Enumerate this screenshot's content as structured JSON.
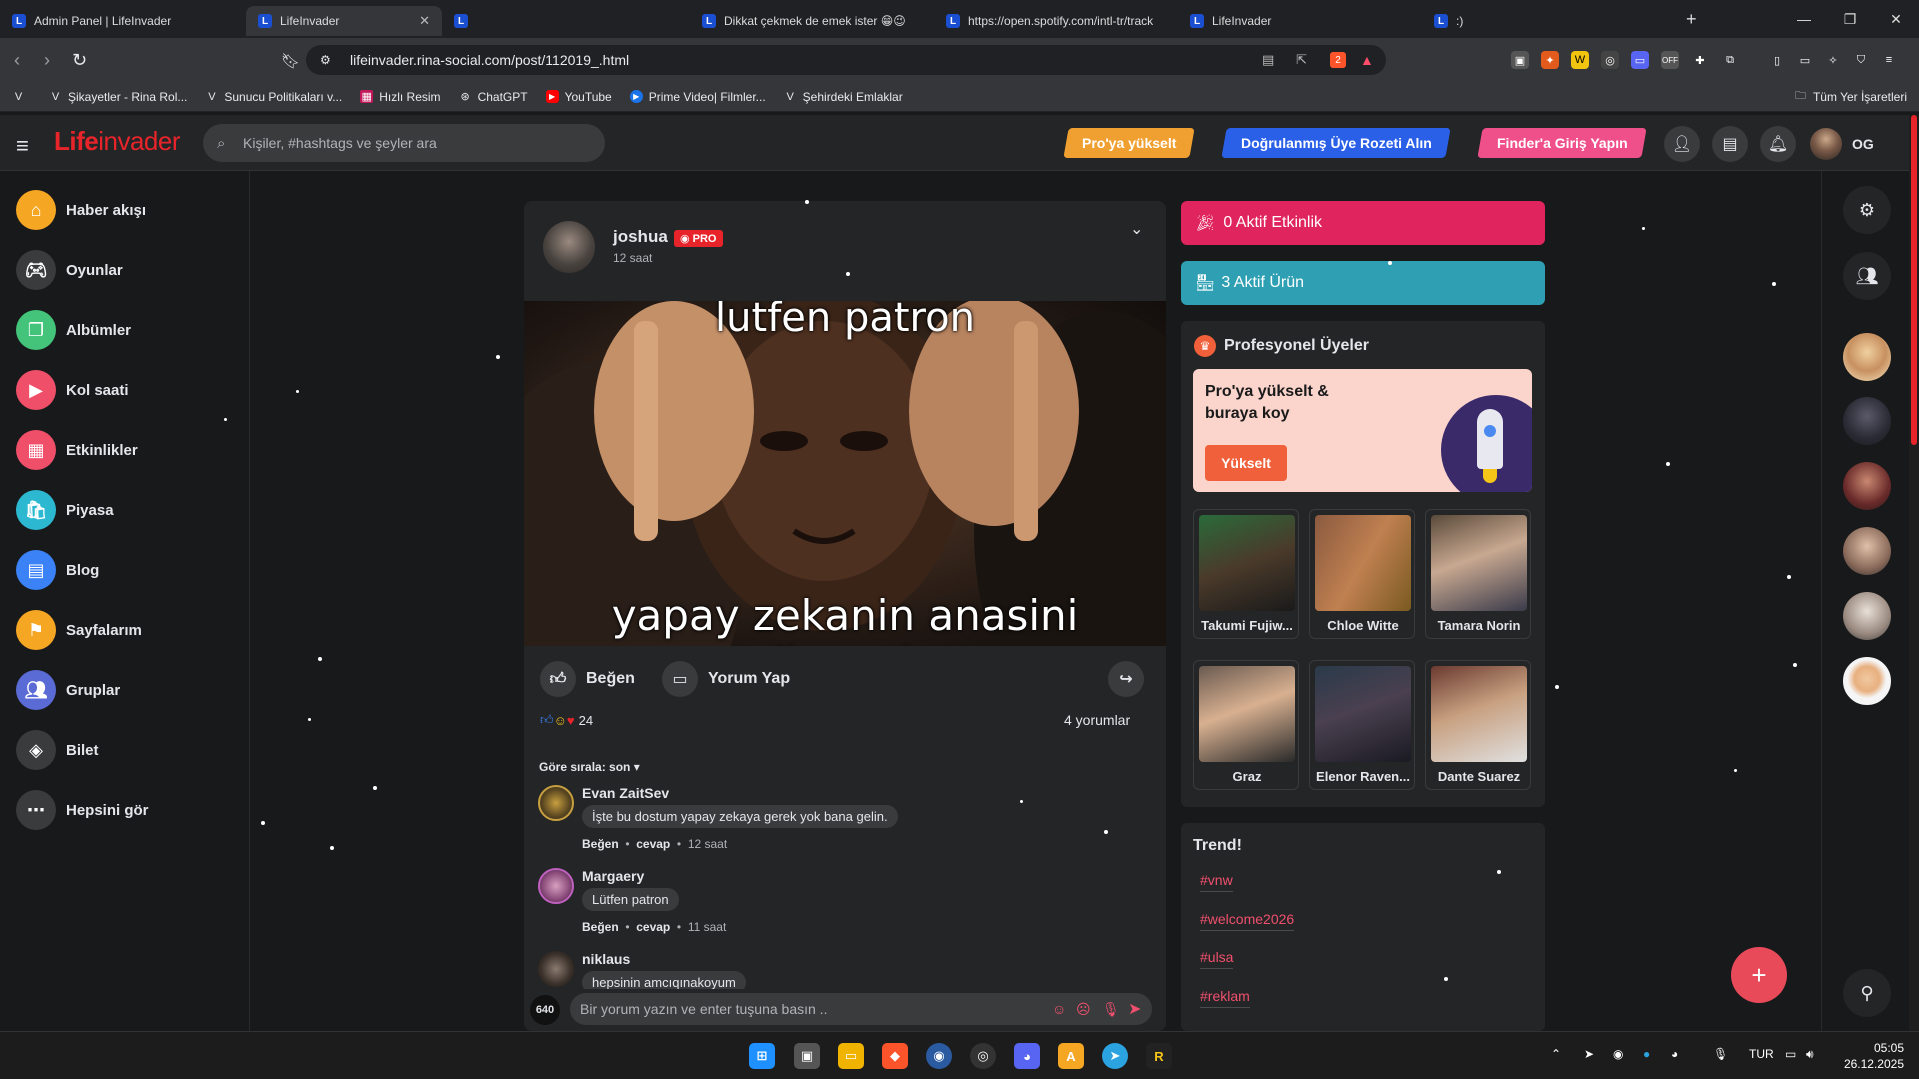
{
  "browser": {
    "tabs": [
      {
        "title": "Admin Panel | LifeInvader",
        "active": false
      },
      {
        "title": "LifeInvader",
        "active": true
      },
      {
        "title": "",
        "active": false
      },
      {
        "title": "Dikkat çekmek de emek ister 😁😉",
        "active": false
      },
      {
        "title": "https://open.spotify.com/intl-tr/track",
        "active": false
      },
      {
        "title": "LifeInvader",
        "active": false
      },
      {
        "title": ":)",
        "active": false
      }
    ],
    "url": "lifeinvader.rina-social.com/post/112019_.html",
    "bookmarks": [
      {
        "label": "",
        "icon": "v-icon"
      },
      {
        "label": "Şikayetler - Rina Rol...",
        "icon": "v-icon"
      },
      {
        "label": "Sunucu Politikaları v...",
        "icon": "v-icon"
      },
      {
        "label": "Hızlı Resim",
        "icon": "image-icon"
      },
      {
        "label": "ChatGPT",
        "icon": "chatgpt-icon"
      },
      {
        "label": "YouTube",
        "icon": "youtube-icon"
      },
      {
        "label": "Prime Video| Filmler...",
        "icon": "prime-icon"
      },
      {
        "label": "Şehirdeki Emlaklar",
        "icon": "v-icon"
      }
    ],
    "all_bookmarks": "Tüm Yer İşaretleri",
    "brave_badge": "2"
  },
  "site": {
    "logo_bold": "Life",
    "logo_thin": "invader",
    "search_placeholder": "Kişiler, #hashtags ve şeyler ara",
    "pills": [
      {
        "label": "Pro'ya yükselt",
        "color": "#f0a030"
      },
      {
        "label": "Doğrulanmış Üye Rozeti Alın",
        "color": "#2a60e8"
      },
      {
        "label": "Finder'a Giriş Yapın",
        "color": "#f0508a"
      }
    ],
    "user_initials": "OG"
  },
  "sidebar": {
    "items": [
      {
        "label": "Haber akışı",
        "icon": "home-icon",
        "color": "#f5a623"
      },
      {
        "label": "Oyunlar",
        "icon": "gamepad-icon",
        "color": "#3a3b3c"
      },
      {
        "label": "Albümler",
        "icon": "album-icon",
        "color": "#43c47a"
      },
      {
        "label": "Kol saati",
        "icon": "watch-icon",
        "color": "#f04f6a"
      },
      {
        "label": "Etkinlikler",
        "icon": "calendar-icon",
        "color": "#f04f6a"
      },
      {
        "label": "Piyasa",
        "icon": "market-icon",
        "color": "#2bb8d0"
      },
      {
        "label": "Blog",
        "icon": "blog-icon",
        "color": "#3b82f6"
      },
      {
        "label": "Sayfalarım",
        "icon": "flag-icon",
        "color": "#f5a623"
      },
      {
        "label": "Gruplar",
        "icon": "group-icon",
        "color": "#5b6bd6"
      },
      {
        "label": "Bilet",
        "icon": "ticket-icon",
        "color": "#3a3b3c"
      },
      {
        "label": "Hepsini gör",
        "icon": "more-icon",
        "color": "#3a3b3c"
      }
    ]
  },
  "post": {
    "author": "joshua",
    "badge": "PRO",
    "time": "12 saat",
    "meme_top": "lutfen patron",
    "meme_bottom": "yapay zekanin anasini sikmeyin",
    "like_label": "Beğen",
    "comment_label": "Yorum Yap",
    "reaction_count": "24",
    "comment_count": "4 yorumlar",
    "sort_label": "Göre sırala: son",
    "comments": [
      {
        "name": "Evan ZaitSev",
        "text": "İşte bu dostum yapay zekaya gerek yok bana gelin.",
        "like": "Beğen",
        "reply": "cevap",
        "time": "12 saat"
      },
      {
        "name": "Margaery",
        "text": "Lütfen patron",
        "like": "Beğen",
        "reply": "cevap",
        "time": "11 saat"
      },
      {
        "name": "niklaus",
        "text": "hepsinin amcıqınakoyum",
        "like": "",
        "reply": "",
        "time": ""
      }
    ],
    "comment_placeholder": "Bir yorum yazın ve enter tuşuna basın ..",
    "char_counter": "640"
  },
  "right": {
    "events": "0 Aktif Etkinlik",
    "products": "3 Aktif Ürün",
    "pro_title": "Profesyonel Üyeler",
    "promo_text": "Pro'ya yükselt & buraya koy",
    "promo_btn": "Yükselt",
    "members": [
      {
        "name": "Takumi Fujiw...",
        "color": "#4a3a2a"
      },
      {
        "name": "Chloe Witte",
        "color": "#9a5a30"
      },
      {
        "name": "Tamara Norin",
        "color": "#6a6070"
      },
      {
        "name": "Graz",
        "color": "#5a4a40"
      },
      {
        "name": "Elenor Raven...",
        "color": "#3a3a44"
      },
      {
        "name": "Dante Suarez",
        "color": "#7a5a48"
      }
    ],
    "trend_title": "Trend!",
    "tags": [
      "#vnw",
      "#welcome2026",
      "#ulsa",
      "#reklam"
    ]
  },
  "taskbar": {
    "lang": "TUR",
    "time": "05:05",
    "date": "26.12.2025"
  }
}
